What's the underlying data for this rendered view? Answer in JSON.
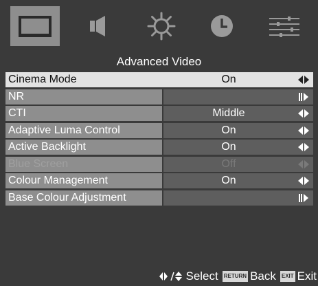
{
  "tabs": [
    {
      "icon": "picture-icon",
      "active": true
    },
    {
      "icon": "speaker-icon",
      "active": false
    },
    {
      "icon": "gear-icon",
      "active": false
    },
    {
      "icon": "clock-icon",
      "active": false
    },
    {
      "icon": "sliders-icon",
      "active": false
    }
  ],
  "menu": {
    "title": "Advanced Video",
    "items": [
      {
        "label": "Cinema Mode",
        "value": "On",
        "control": "left-right-arrows",
        "state": "selected"
      },
      {
        "label": "NR",
        "value": "",
        "control": "enter-arrow",
        "state": "normal"
      },
      {
        "label": "CTI",
        "value": "Middle",
        "control": "left-right-arrows",
        "state": "normal"
      },
      {
        "label": "Adaptive Luma Control",
        "value": "On",
        "control": "left-right-arrows",
        "state": "normal"
      },
      {
        "label": "Active Backlight",
        "value": "On",
        "control": "left-right-arrows",
        "state": "normal"
      },
      {
        "label": "Blue Screen",
        "value": "Off",
        "control": "left-right-arrows",
        "state": "disabled"
      },
      {
        "label": "Colour Management",
        "value": "On",
        "control": "left-right-arrows",
        "state": "normal"
      },
      {
        "label": "Base Colour Adjustment",
        "value": "",
        "control": "enter-arrow",
        "state": "normal"
      }
    ]
  },
  "footer": {
    "select_label": "Select",
    "return_key": "RETURN",
    "back_label": "Back",
    "exit_key": "EXIT",
    "exit_label": "Exit"
  },
  "colors": {
    "background": "#3a3a3a",
    "active_tab": "#8e8e8e",
    "label_bg": "#8e8e8e",
    "value_bg": "#5e5e5e",
    "selected_bg": "#e2e2e2"
  }
}
